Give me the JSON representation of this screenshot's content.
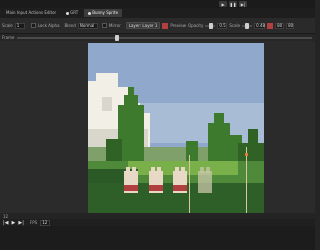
{
  "top": {
    "play_icons": [
      "play-icon",
      "pause-icon",
      "step-icon"
    ]
  },
  "tabs": [
    {
      "label": "Main Input Actions Editor"
    },
    {
      "label": "GRT"
    },
    {
      "label": "Bunny Sprite"
    }
  ],
  "toolbar": {
    "scale_label": "Scale",
    "scale_value": "1",
    "lock_alpha_label": "Lock Alpha",
    "blend_label": "Blend",
    "blend_value": "Normal",
    "mirror_label": "Mirror",
    "layer_value": "Layer: Layer 1",
    "preview_label": "Preview",
    "opacity_label": "Opacity",
    "opacity_value": "0.5",
    "scale2_label": "Scale",
    "value_a": "0.48",
    "value_b": "80",
    "value_c": "80"
  },
  "frame": {
    "label": "Frame"
  },
  "status": {
    "left_value": "12"
  },
  "playbar": {
    "speed_label": "FPS",
    "speed_value": "12"
  },
  "colors": {
    "sky": "#8fa8cc",
    "grass": "#4f8a3a",
    "accent": "#b04040"
  }
}
